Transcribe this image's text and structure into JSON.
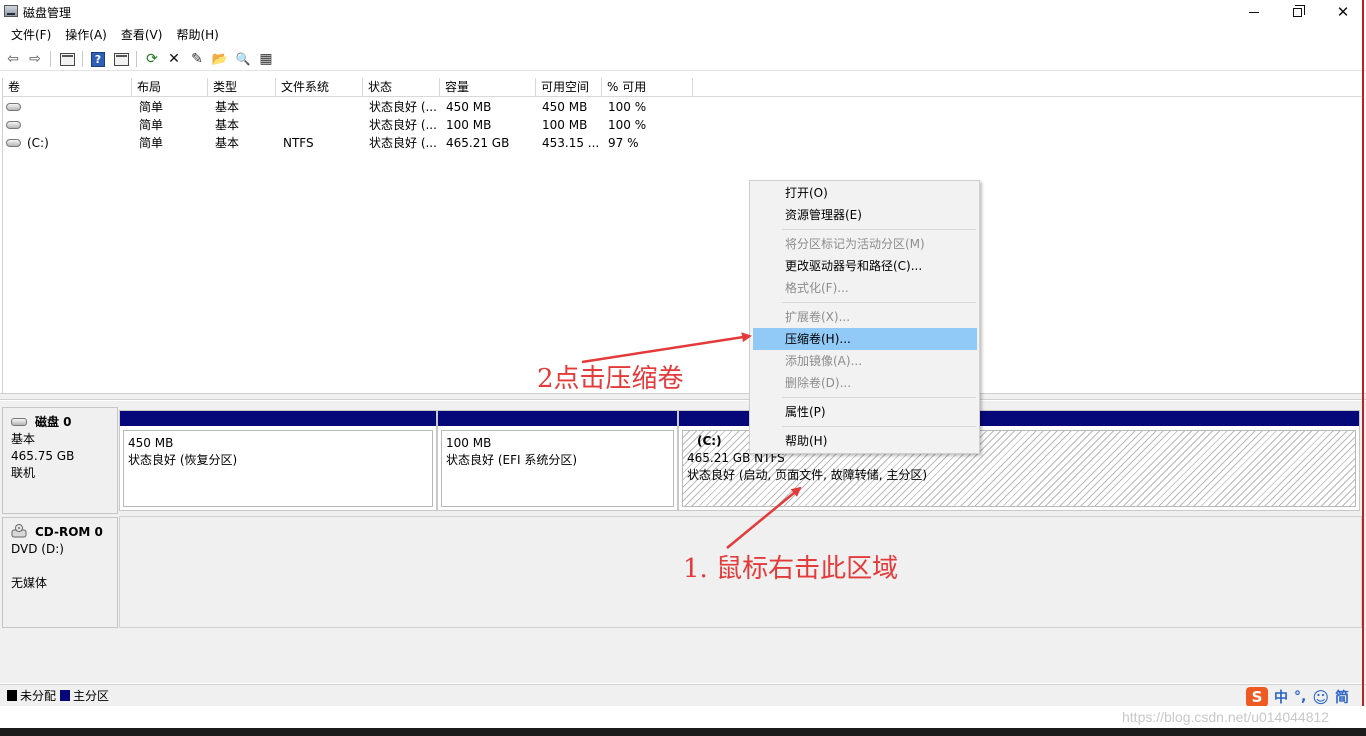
{
  "window": {
    "title": "磁盘管理",
    "icons": {
      "app": "disk-management-icon",
      "minimize": "minimize-icon",
      "maximize": "restore-icon",
      "close": "close-icon"
    },
    "close_glyph": "✕"
  },
  "menu": {
    "items": [
      "文件(F)",
      "操作(A)",
      "查看(V)",
      "帮助(H)"
    ]
  },
  "toolbar": {
    "buttons": [
      {
        "name": "back-icon",
        "glyph": "⇦"
      },
      {
        "name": "forward-icon",
        "glyph": "⇨"
      },
      {
        "name": "console-icon",
        "glyph": ""
      },
      {
        "name": "help-icon",
        "glyph": "?"
      },
      {
        "name": "properties-icon",
        "glyph": ""
      },
      {
        "name": "refresh-icon",
        "glyph": "⟳"
      },
      {
        "name": "delete-icon",
        "glyph": "✕"
      },
      {
        "name": "checklist-icon",
        "glyph": "✎"
      },
      {
        "name": "open-folder-icon",
        "glyph": "📂"
      },
      {
        "name": "search-icon",
        "glyph": "🔍"
      },
      {
        "name": "settings-icon",
        "glyph": "▦"
      }
    ]
  },
  "volume_list": {
    "columns": [
      "卷",
      "布局",
      "类型",
      "文件系统",
      "状态",
      "容量",
      "可用空间",
      "% 可用"
    ],
    "rows": [
      [
        "",
        "简单",
        "基本",
        "",
        "状态良好 (...",
        "450 MB",
        "450 MB",
        "100 %"
      ],
      [
        "",
        "简单",
        "基本",
        "",
        "状态良好 (...",
        "100 MB",
        "100 MB",
        "100 %"
      ],
      [
        "(C:)",
        "简单",
        "基本",
        "NTFS",
        "状态良好 (...",
        "465.21 GB",
        "453.15 ...",
        "97 %"
      ]
    ]
  },
  "disks": [
    {
      "name": "磁盘 0",
      "type": "基本",
      "size": "465.75 GB",
      "status": "联机",
      "partitions": [
        {
          "title": "",
          "size": "450 MB",
          "status": "状态良好 (恢复分区)"
        },
        {
          "title": "",
          "size": "100 MB",
          "status": "状态良好 (EFI 系统分区)"
        },
        {
          "title": "(C:)",
          "size": "465.21 GB NTFS",
          "status": "状态良好 (启动, 页面文件, 故障转储, 主分区)"
        }
      ]
    },
    {
      "name": "CD-ROM 0",
      "type": "DVD (D:)",
      "size": "",
      "status": "无媒体"
    }
  ],
  "legend": [
    {
      "label": "未分配",
      "color": "#000000"
    },
    {
      "label": "主分区",
      "color": "#06087a"
    }
  ],
  "context_menu": {
    "items": [
      {
        "label": "打开(O)",
        "disabled": false,
        "highlighted": false
      },
      {
        "label": "资源管理器(E)",
        "disabled": false,
        "highlighted": false
      },
      {
        "label": "将分区标记为活动分区(M)",
        "disabled": true,
        "highlighted": false
      },
      {
        "label": "更改驱动器号和路径(C)...",
        "disabled": false,
        "highlighted": false
      },
      {
        "label": "格式化(F)...",
        "disabled": true,
        "highlighted": false
      },
      {
        "label": "扩展卷(X)...",
        "disabled": true,
        "highlighted": false
      },
      {
        "label": "压缩卷(H)...",
        "disabled": false,
        "highlighted": true
      },
      {
        "label": "添加镜像(A)...",
        "disabled": true,
        "highlighted": false
      },
      {
        "label": "删除卷(D)...",
        "disabled": true,
        "highlighted": false
      },
      {
        "label": "属性(P)",
        "disabled": false,
        "highlighted": false
      },
      {
        "label": "帮助(H)",
        "disabled": false,
        "highlighted": false
      }
    ]
  },
  "annotations": {
    "step2": "2点击压缩卷",
    "step1": "1. 鼠标右击此区域",
    "color": "#e43a3a"
  },
  "ime": {
    "logo": "S",
    "items": [
      "中",
      "°,",
      "☺",
      "简"
    ]
  },
  "watermark": "https://blog.csdn.net/u014044812"
}
